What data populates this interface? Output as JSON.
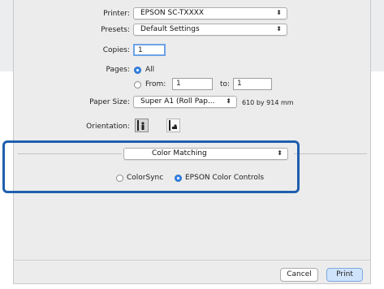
{
  "dialog": {
    "printer_label": "Printer:",
    "printer_value": "EPSON SC-TXXXX",
    "presets_label": "Presets:",
    "presets_value": "Default Settings",
    "copies_label": "Copies:",
    "copies_value": "1",
    "pages_label": "Pages:",
    "pages_all": "All",
    "pages_from_label": "From:",
    "pages_from_value": "1",
    "pages_to_label": "to:",
    "pages_to_value": "1",
    "paper_size_label": "Paper Size:",
    "paper_size_value": "Super A1 (Roll Pap...",
    "paper_size_dimensions": "610 by 914 mm",
    "orientation_label": "Orientation:",
    "section_value": "Color Matching",
    "option_colorsync": "ColorSync",
    "option_epson": "EPSON Color Controls",
    "cancel_label": "Cancel",
    "print_label": "Print",
    "popup_arrows": "⬍"
  },
  "colors": {
    "highlight": "#1f5fae",
    "radio_selected": "#2f82e6"
  }
}
